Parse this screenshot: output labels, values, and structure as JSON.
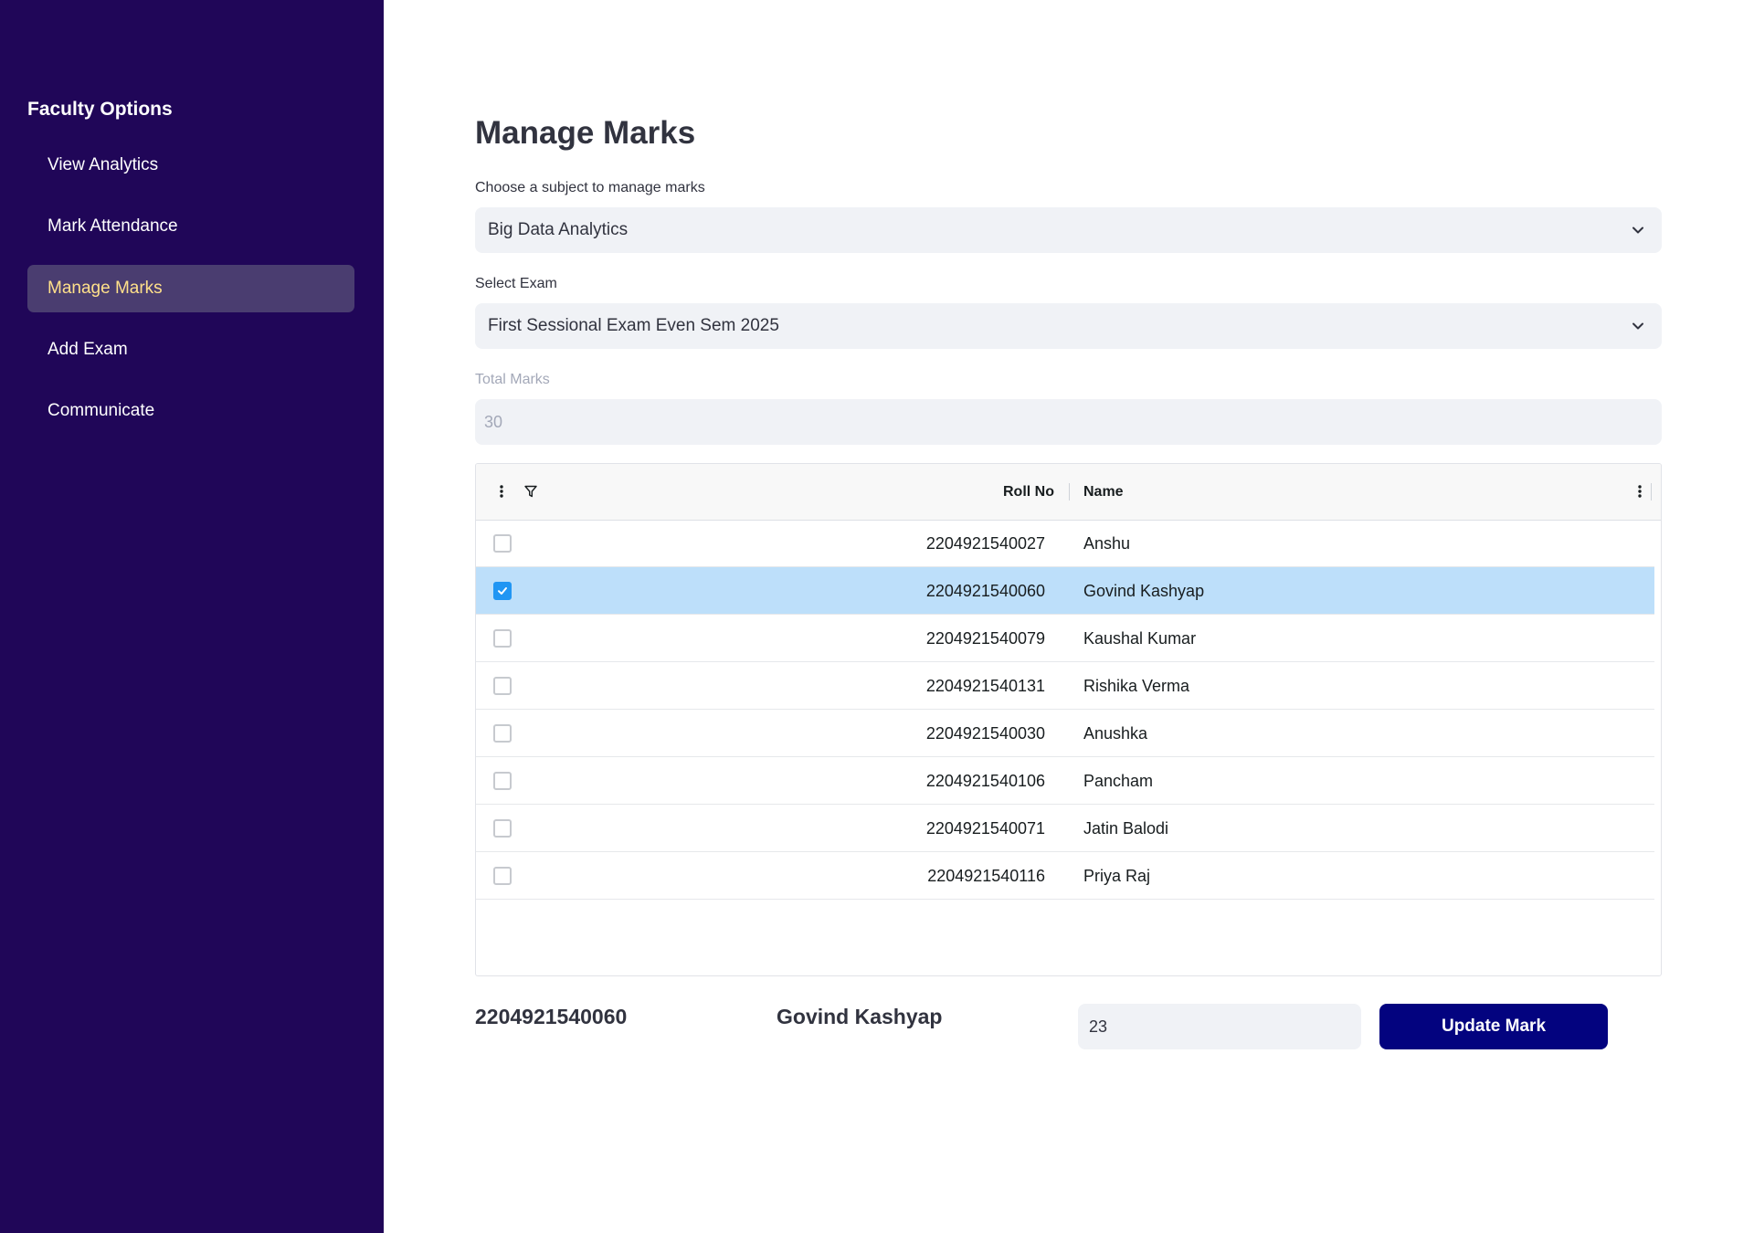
{
  "sidebar": {
    "title": "Faculty Options",
    "items": [
      {
        "label": "View Analytics",
        "active": false
      },
      {
        "label": "Mark Attendance",
        "active": false
      },
      {
        "label": "Manage Marks",
        "active": true
      },
      {
        "label": "Add Exam",
        "active": false
      },
      {
        "label": "Communicate",
        "active": false
      }
    ]
  },
  "main": {
    "title": "Manage Marks",
    "subject": {
      "label": "Choose a subject to manage marks",
      "value": "Big Data Analytics"
    },
    "exam": {
      "label": "Select Exam",
      "value": "First Sessional Exam Even Sem 2025"
    },
    "total_marks": {
      "label": "Total Marks",
      "value": "30"
    }
  },
  "table": {
    "columns": [
      "Roll No",
      "Name"
    ],
    "rows": [
      {
        "roll": "2204921540027",
        "name": "Anshu",
        "selected": false
      },
      {
        "roll": "2204921540060",
        "name": "Govind Kashyap",
        "selected": true
      },
      {
        "roll": "2204921540079",
        "name": "Kaushal Kumar",
        "selected": false
      },
      {
        "roll": "2204921540131",
        "name": "Rishika Verma",
        "selected": false
      },
      {
        "roll": "2204921540030",
        "name": "Anushka",
        "selected": false
      },
      {
        "roll": "2204921540106",
        "name": "Pancham",
        "selected": false
      },
      {
        "roll": "2204921540071",
        "name": "Jatin Balodi",
        "selected": false
      },
      {
        "roll": "2204921540116",
        "name": "Priya Raj",
        "selected": false
      }
    ]
  },
  "editor": {
    "roll": "2204921540060",
    "name": "Govind Kashyap",
    "mark_value": "23",
    "button_label": "Update Mark"
  },
  "colors": {
    "sidebar_bg": "#200658",
    "active_item_bg": "#4a3d70",
    "active_item_text": "#ffe08a",
    "button_bg": "#03037f",
    "selected_row_bg": "#bddffa",
    "checkbox_checked": "#2196f3"
  }
}
